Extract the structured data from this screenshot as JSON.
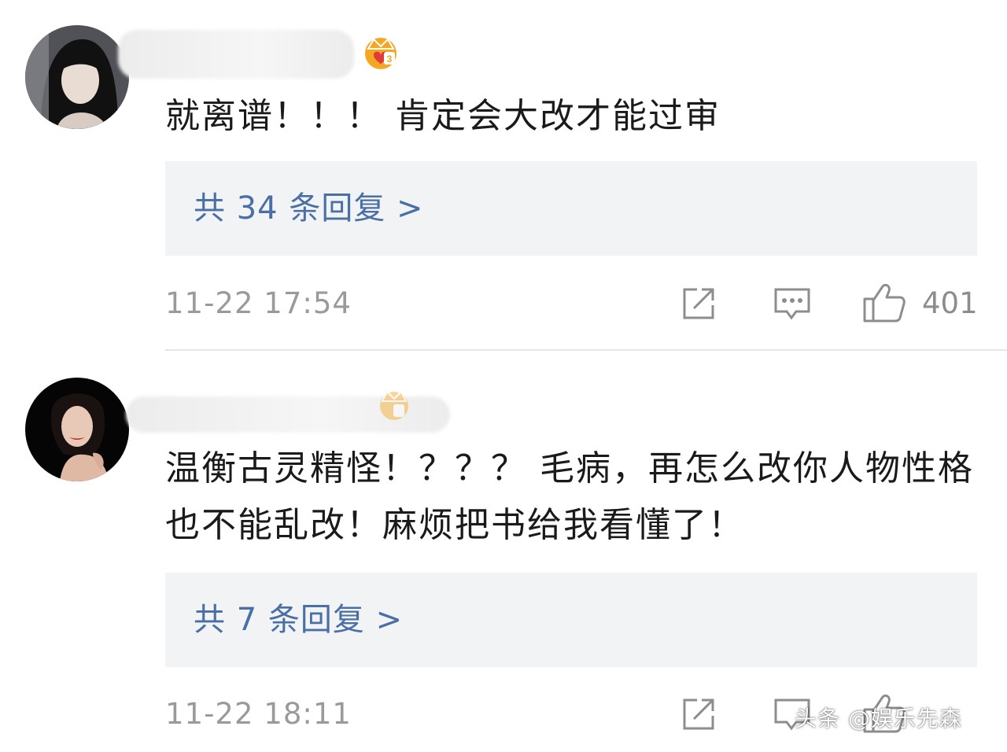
{
  "comments": [
    {
      "text": "就离谱！！！ 肯定会大改才能过审",
      "replies_label": "共 34 条回复 >",
      "timestamp": "11-22 17:54",
      "likes": "401",
      "avatar_icon": "avatar-woman-dark-hair-icon",
      "badge_icon": "vip-crown-badge-icon"
    },
    {
      "text": "温衡古灵精怪！？？？ 毛病，再怎么改你人物性格也不能乱改！麻烦把书给我看懂了！",
      "replies_label": "共 7 条回复 >",
      "timestamp": "11-22 18:11",
      "likes": "",
      "avatar_icon": "avatar-woman-red-lips-icon",
      "badge_icon": "vip-crown-badge-icon"
    }
  ],
  "watermark": "头条 @娱乐先森",
  "colors": {
    "reply_link": "#4a6fa5",
    "reply_box_bg": "#f2f3f5",
    "meta_text": "#9a9a9a",
    "badge_orange": "#f5a623"
  }
}
